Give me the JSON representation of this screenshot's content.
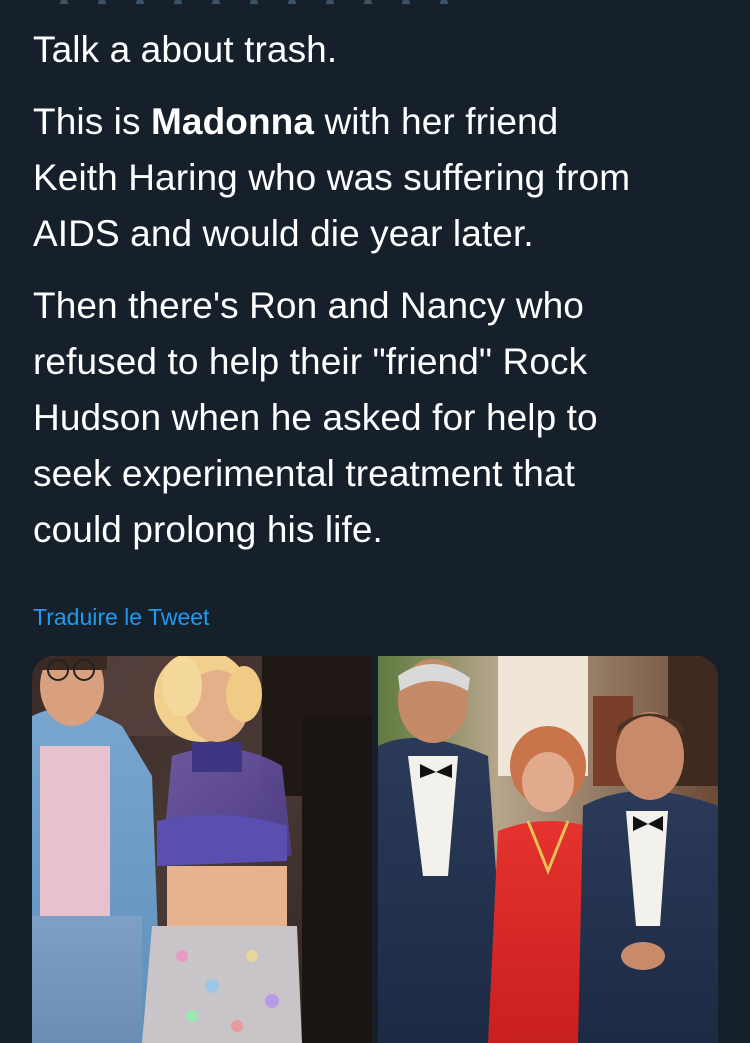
{
  "tweet": {
    "paragraphs": {
      "p1": "Talk a about trash.",
      "p2": {
        "before": "This is ",
        "bold": "Madonna",
        "line1_after": " with her friend",
        "line2": "Keith Haring who was suffering from",
        "line3": "AIDS and would die  year later."
      },
      "p3": {
        "line1": "Then there's Ron and Nancy who",
        "line2": "refused to help their \"friend\" Rock",
        "line3": "Hudson when he asked for help to",
        "line4": "seek experimental treatment that",
        "line5": "could prolong his life."
      }
    },
    "translate_label": "Traduire le Tweet"
  },
  "colors": {
    "background": "#15202b",
    "text": "#ffffff",
    "link": "#1d9bf0"
  }
}
